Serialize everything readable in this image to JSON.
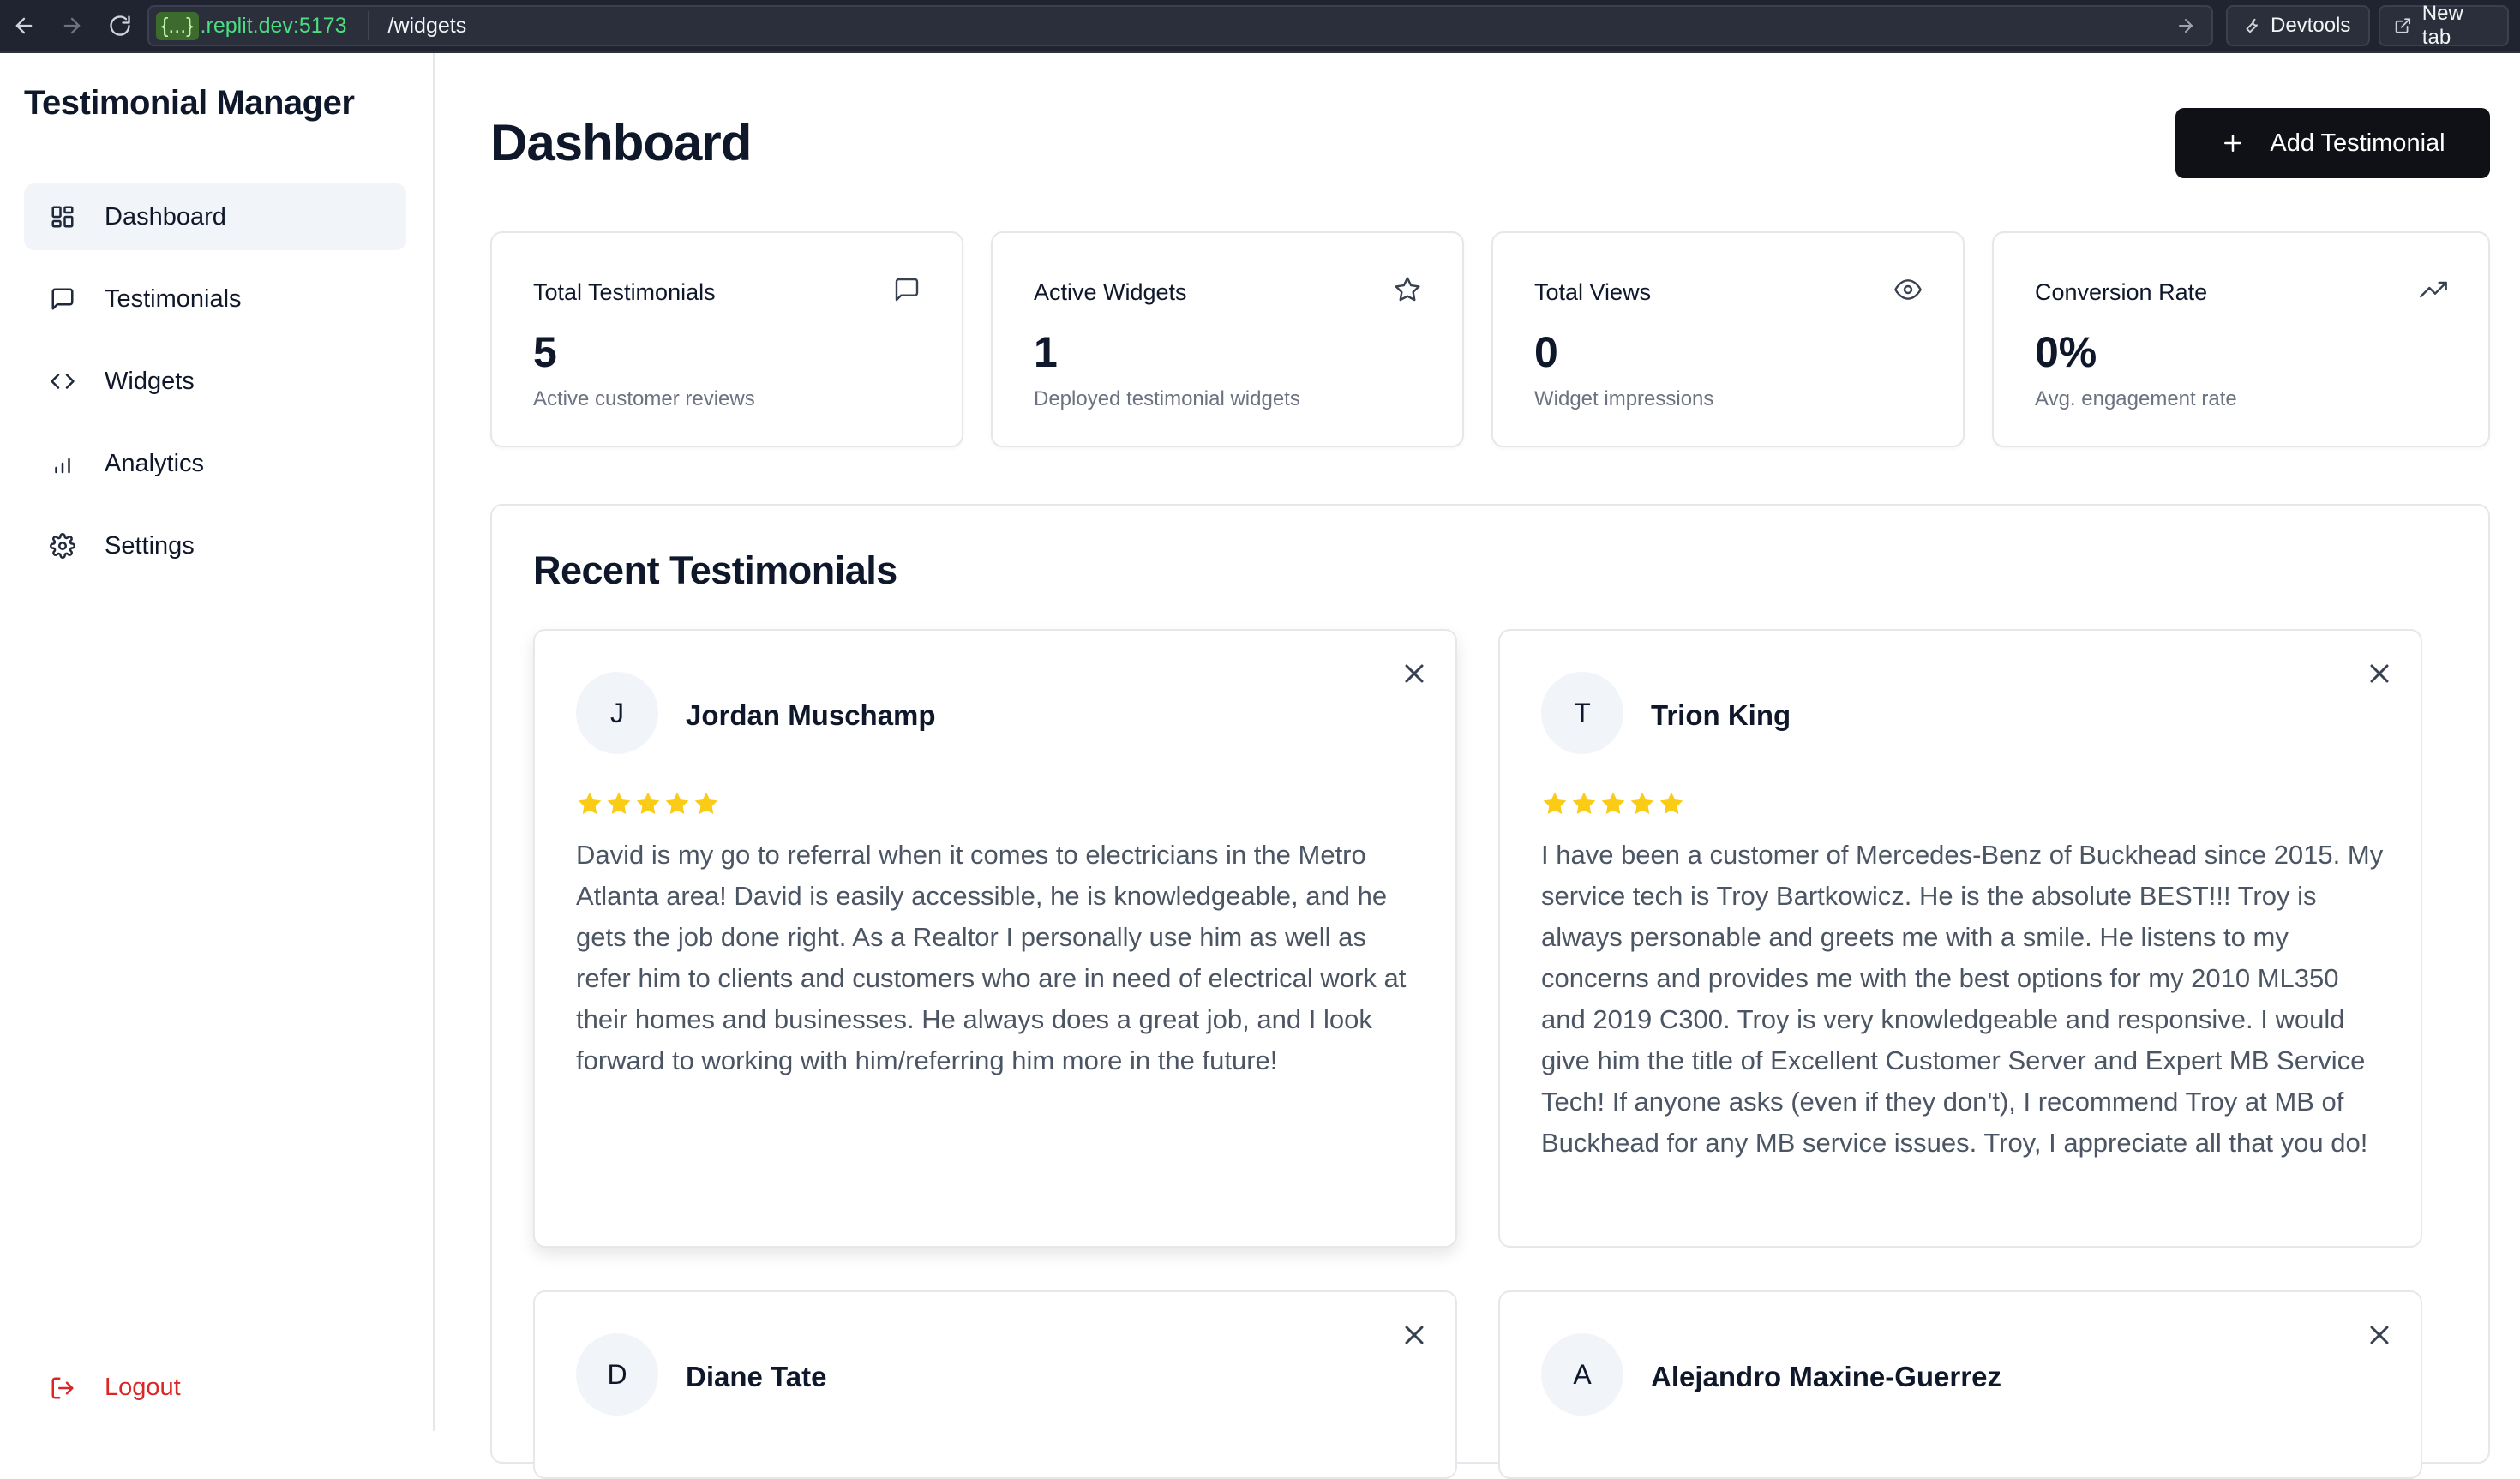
{
  "browser": {
    "url_token": "{...}",
    "url_host": ".replit.dev:5173",
    "url_path": "/widgets",
    "devtools_label": "Devtools",
    "new_tab_label": "New tab"
  },
  "sidebar": {
    "app_title": "Testimonial Manager",
    "items": [
      {
        "label": "Dashboard",
        "icon": "dashboard-grid-icon",
        "active": true
      },
      {
        "label": "Testimonials",
        "icon": "message-square-icon",
        "active": false
      },
      {
        "label": "Widgets",
        "icon": "code-icon",
        "active": false
      },
      {
        "label": "Analytics",
        "icon": "bar-chart-icon",
        "active": false
      },
      {
        "label": "Settings",
        "icon": "gear-icon",
        "active": false
      }
    ],
    "logout_label": "Logout"
  },
  "header": {
    "title": "Dashboard",
    "add_button_label": "Add Testimonial"
  },
  "stats": [
    {
      "title": "Total Testimonials",
      "value": "5",
      "subtitle": "Active customer reviews",
      "icon": "message-square-icon"
    },
    {
      "title": "Active Widgets",
      "value": "1",
      "subtitle": "Deployed testimonial widgets",
      "icon": "star-icon"
    },
    {
      "title": "Total Views",
      "value": "0",
      "subtitle": "Widget impressions",
      "icon": "eye-icon"
    },
    {
      "title": "Conversion Rate",
      "value": "0%",
      "subtitle": "Avg. engagement rate",
      "icon": "trending-up-icon"
    }
  ],
  "recent": {
    "title": "Recent Testimonials",
    "testimonials": [
      {
        "initial": "J",
        "name": "Jordan Muschamp",
        "rating": 5,
        "text": "David is my go to referral when it comes to electricians in the Metro Atlanta area! David is easily accessible, he is knowledgeable, and he gets the job done right. As a Realtor I personally use him as well as refer him to clients and customers who are in need of electrical work at their homes and businesses. He always does a great job, and I look forward to working with him/referring him more in the future!"
      },
      {
        "initial": "T",
        "name": "Trion King",
        "rating": 5,
        "text": "I have been a customer of Mercedes-Benz of Buckhead since 2015. My service tech is Troy Bartkowicz. He is the absolute BEST!!! Troy is always personable and greets me with a smile. He listens to my concerns and provides me with the best options for my 2010 ML350 and 2019 C300. Troy is very knowledgeable and responsive. I would give him the title of Excellent Customer Server and Expert MB Service Tech! If anyone asks (even if they don't), I recommend Troy at MB of Buckhead for any MB service issues. Troy, I appreciate all that you do!"
      },
      {
        "initial": "D",
        "name": "Diane Tate"
      },
      {
        "initial": "A",
        "name": "Alejandro Maxine-Guerrez"
      }
    ]
  },
  "colors": {
    "accent_dark": "#0f1117",
    "star": "#facc15",
    "logout": "#dc2626",
    "active_nav_bg": "#f1f5f9"
  }
}
